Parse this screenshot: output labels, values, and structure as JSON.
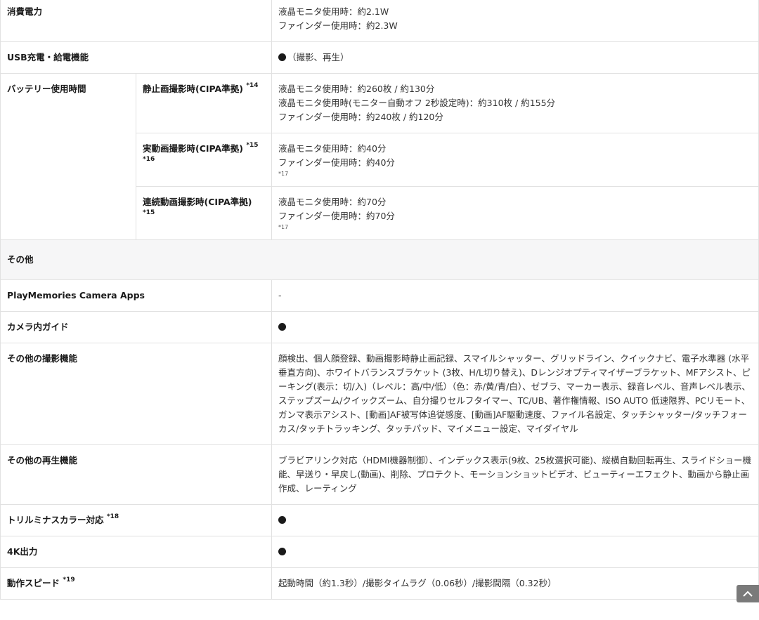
{
  "rows": {
    "power": {
      "label": "消費電力",
      "values": [
        "液晶モニタ使用時：約2.1W",
        "ファインダー使用時：約2.3W"
      ]
    },
    "usb": {
      "label": "USB充電・給電機能",
      "value": "（撮影、再生）"
    },
    "battery": {
      "label": "バッテリー使用時間",
      "still": {
        "label": "静止画撮影時(CIPA準拠)",
        "note": "*14",
        "values": [
          "液晶モニタ使用時：約260枚 / 約130分",
          "液晶モニタ使用時(モニター自動オフ 2秒設定時)：約310枚 / 約155分",
          "ファインダー使用時：約240枚 / 約120分"
        ]
      },
      "movie": {
        "label": "実動画撮影時(CIPA準拠)",
        "note": "*15 *16",
        "values": [
          "液晶モニタ使用時：約40分",
          "ファインダー使用時：約40分"
        ],
        "footnote": "*17"
      },
      "continuous": {
        "label": "連続動画撮影時(CIPA準拠)",
        "note": "*15",
        "values": [
          "液晶モニタ使用時：約70分",
          "ファインダー使用時：約70分"
        ],
        "footnote": "*17"
      }
    },
    "other_section": {
      "label": "その他"
    },
    "playmemories": {
      "label": "PlayMemories Camera Apps",
      "value": "-"
    },
    "guide": {
      "label": "カメラ内ガイド"
    },
    "shooting": {
      "label": "その他の撮影機能",
      "value": "顔検出、個人顔登録、動画撮影時静止画記録、スマイルシャッター、グリッドライン、クイックナビ、電子水準器 (水平垂直方向)、ホワイトバランスブラケット (3枚、H/L切り替え)、Dレンジオプティマイザーブラケット、MFアシスト、ピーキング(表示：切/入)（レベル：高/中/低）（色：赤/黄/青/白）、ゼブラ、マーカー表示、録音レベル、音声レベル表示、ステップズーム/クイックズーム、自分撮りセルフタイマー、TC/UB、著作権情報、ISO AUTO 低速限界、PCリモート、ガンマ表示アシスト、[動画]AF被写体追従感度、[動画]AF駆動速度、ファイル名設定、タッチシャッター/タッチフォーカス/タッチトラッキング、タッチパッド、マイメニュー設定、マイダイヤル"
    },
    "playback": {
      "label": "その他の再生機能",
      "value": "ブラビアリンク対応（HDMI機器制御）、インデックス表示(9枚、25枚選択可能)、縦横自動回転再生、スライドショー機能、早送り・早戻し(動画)、削除、プロテクト、モーションショットビデオ、ビューティーエフェクト、動画から静止画作成、レーティング"
    },
    "triluminos": {
      "label": "トリルミナスカラー対応",
      "note": "*18"
    },
    "k4": {
      "label": "4K出力"
    },
    "speed": {
      "label": "動作スピード",
      "note": "*19",
      "value": "起動時間（約1.3秒）/撮影タイムラグ（0.06秒）/撮影間隔（0.32秒）"
    }
  },
  "icons": {
    "dot": "filled-circle-icon",
    "back_to_top": "chevron-up-icon"
  }
}
